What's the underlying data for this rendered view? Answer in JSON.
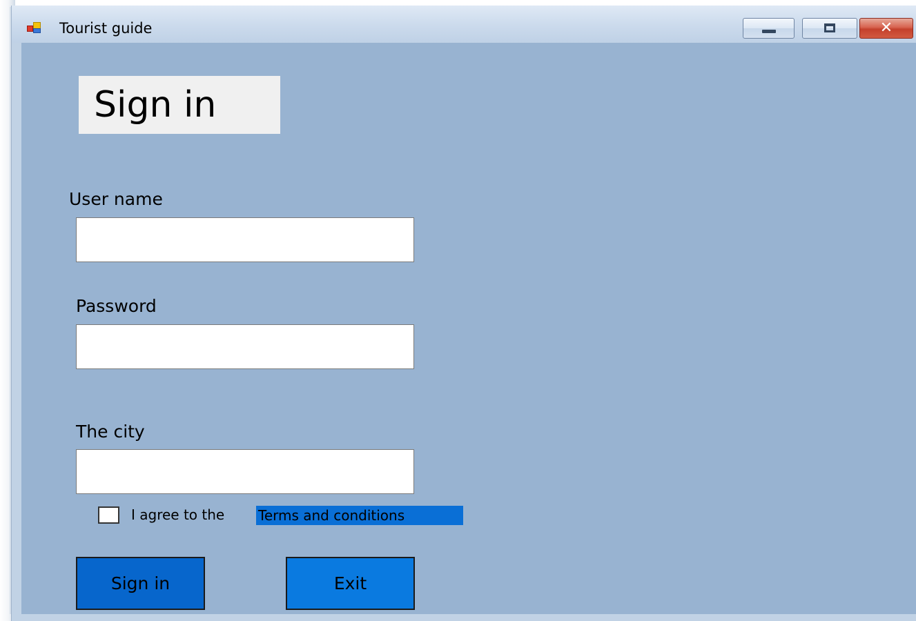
{
  "window": {
    "title": "Tourist guide",
    "icon": "app-icon",
    "controls": {
      "minimize": "minimize-icon",
      "maximize": "maximize-icon",
      "close": "close-icon",
      "close_glyph": "✕"
    }
  },
  "form": {
    "heading": "Sign in",
    "username_label": "User name",
    "username_value": "",
    "password_label": "Password",
    "password_value": "",
    "city_label": "The city",
    "city_value": "",
    "agree_checked": false,
    "agree_text": "I agree to the",
    "terms_link": "Terms and conditions",
    "signin_button": "Sign in",
    "exit_button": "Exit"
  },
  "colors": {
    "client_background": "#98b3d1",
    "signin_button": "#0766cc",
    "exit_button": "#0a7ae0",
    "terms_highlight": "#0a6fd6",
    "heading_background": "#f0f0f0"
  }
}
